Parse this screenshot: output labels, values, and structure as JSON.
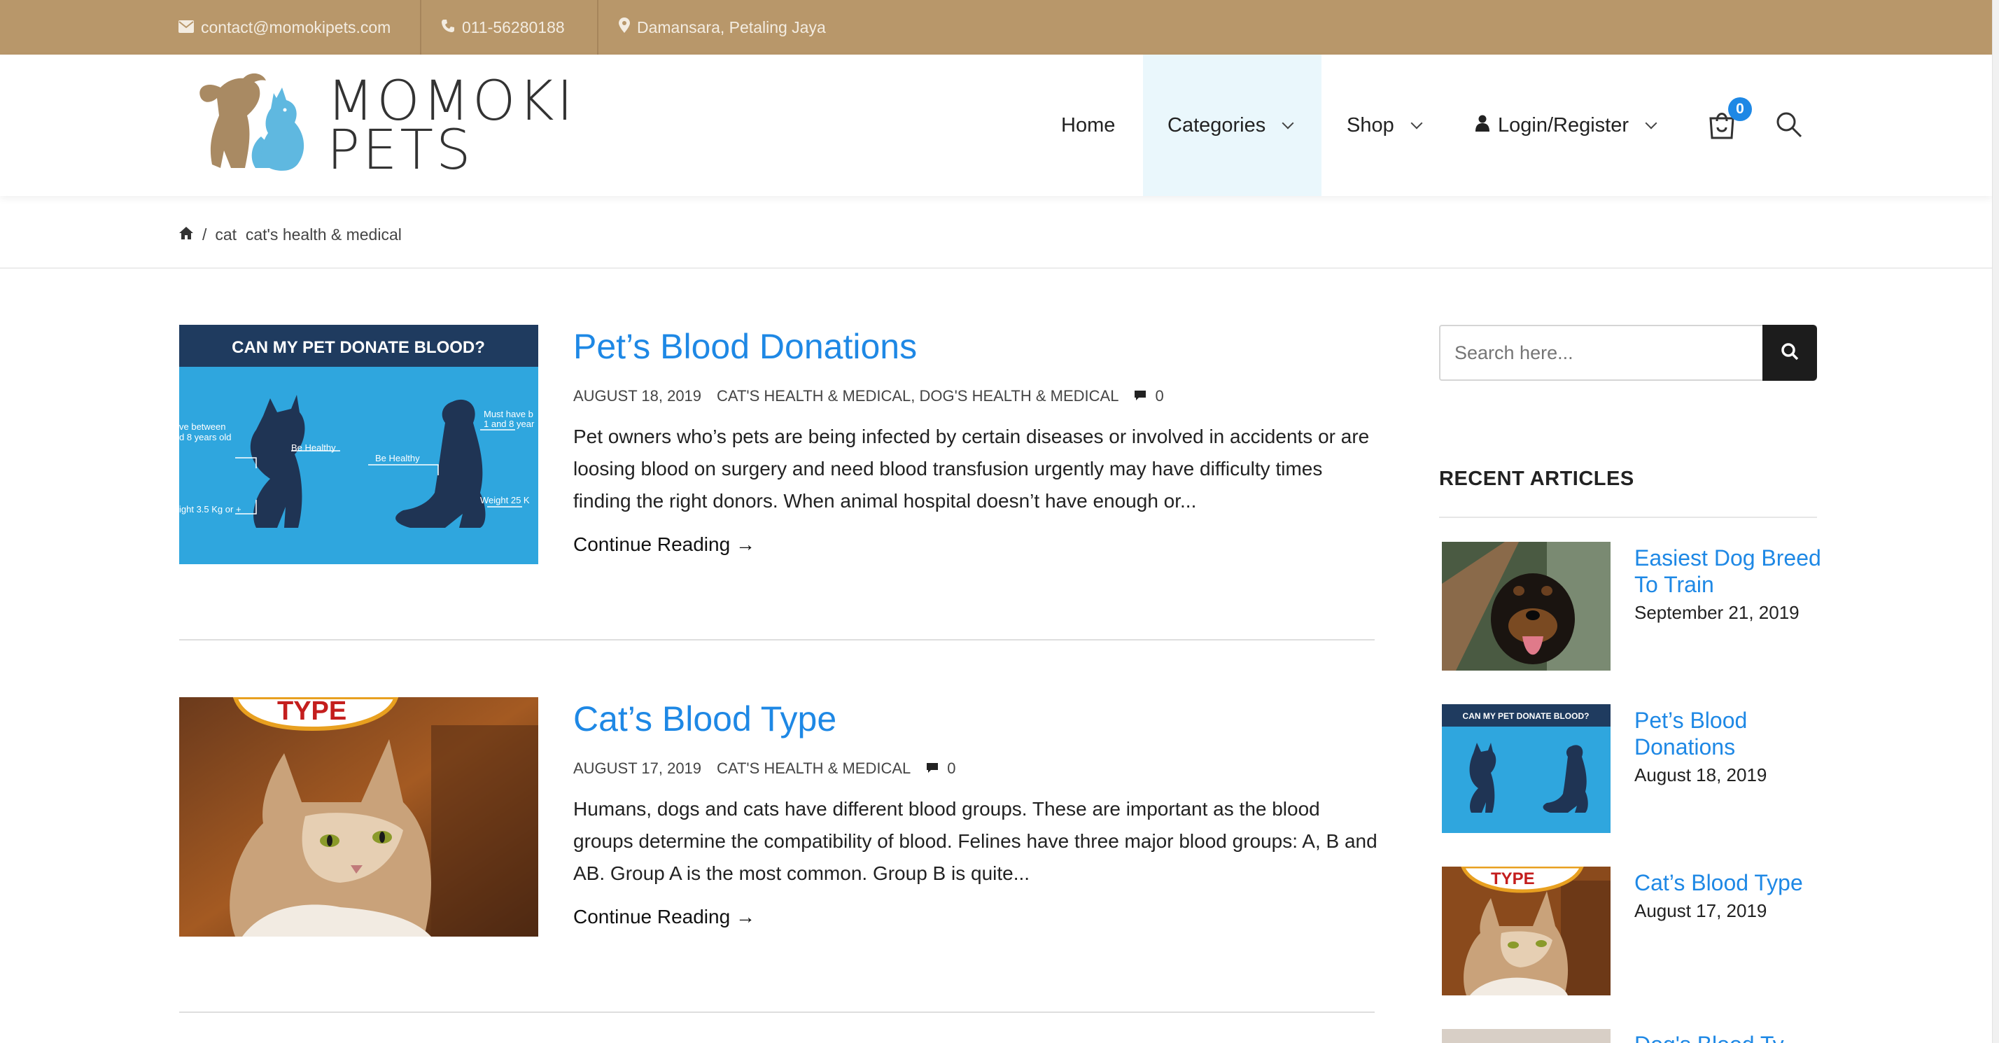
{
  "topbar": {
    "email": "contact@momokipets.com",
    "phone": "011-56280188",
    "location": "Damansara, Petaling Jaya",
    "bg_color": "#b8976a"
  },
  "logo": {
    "line1": "MOMOKI",
    "line2": "PETS"
  },
  "nav": {
    "home": "Home",
    "categories": "Categories",
    "shop": "Shop",
    "login": "Login/Register",
    "cart_count": "0"
  },
  "breadcrumb": {
    "home_icon": "home-icon",
    "separator": "/",
    "path": "cat  cat's health & medical"
  },
  "posts": [
    {
      "title": "Pet’s Blood Donations",
      "date": "AUGUST 18, 2019",
      "categories": "CAT'S HEALTH & MEDICAL, DOG'S HEALTH & MEDICAL",
      "comments": "0",
      "excerpt": "Pet owners who’s pets are being infected by certain diseases or involved in accidents or are loosing blood on surgery and need blood transfusion urgently may have difficulty times finding the right donors. When animal hospital doesn’t have enough or...",
      "continue": "Continue Reading →",
      "image": {
        "heading": "CAN MY PET DONATE BLOOD?",
        "label_age": "ve between\nd 8 years old",
        "label_healthy1": "Be Healthy",
        "label_healthy2": "Be Healthy",
        "label_must": "Must have b\n1 and 8 year",
        "label_weight1": "ight 3.5 Kg or +",
        "label_weight2": "Weight 25 K"
      }
    },
    {
      "title": "Cat’s Blood Type",
      "date": "AUGUST 17, 2019",
      "categories": "CAT'S HEALTH & MEDICAL",
      "comments": "0",
      "excerpt": "Humans, dogs and cats  have different blood groups. These are important as the blood groups determine the compatibility of blood. Felines have three major blood groups: A, B and AB. Group A is the most common. Group B is quite...",
      "continue": "Continue Reading →",
      "image": {
        "sign_text": "TYPE"
      }
    }
  ],
  "sidebar": {
    "search_placeholder": "Search here...",
    "recent_title": "RECENT ARTICLES",
    "recent": [
      {
        "title": "Easiest Dog Breed To Train",
        "date": "September 21, 2019"
      },
      {
        "title": "Pet’s Blood Donations",
        "date": "August 18, 2019",
        "thumb_heading": "CAN MY PET DONATE BLOOD?"
      },
      {
        "title": "Cat’s Blood Type",
        "date": "August 17, 2019",
        "thumb_sign": "TYPE"
      },
      {
        "title": "Dog's Blood Ty",
        "date": ""
      }
    ]
  },
  "colors": {
    "accent": "#1e88e5",
    "topbar": "#b8976a",
    "active_nav": "#eaf7fc"
  }
}
